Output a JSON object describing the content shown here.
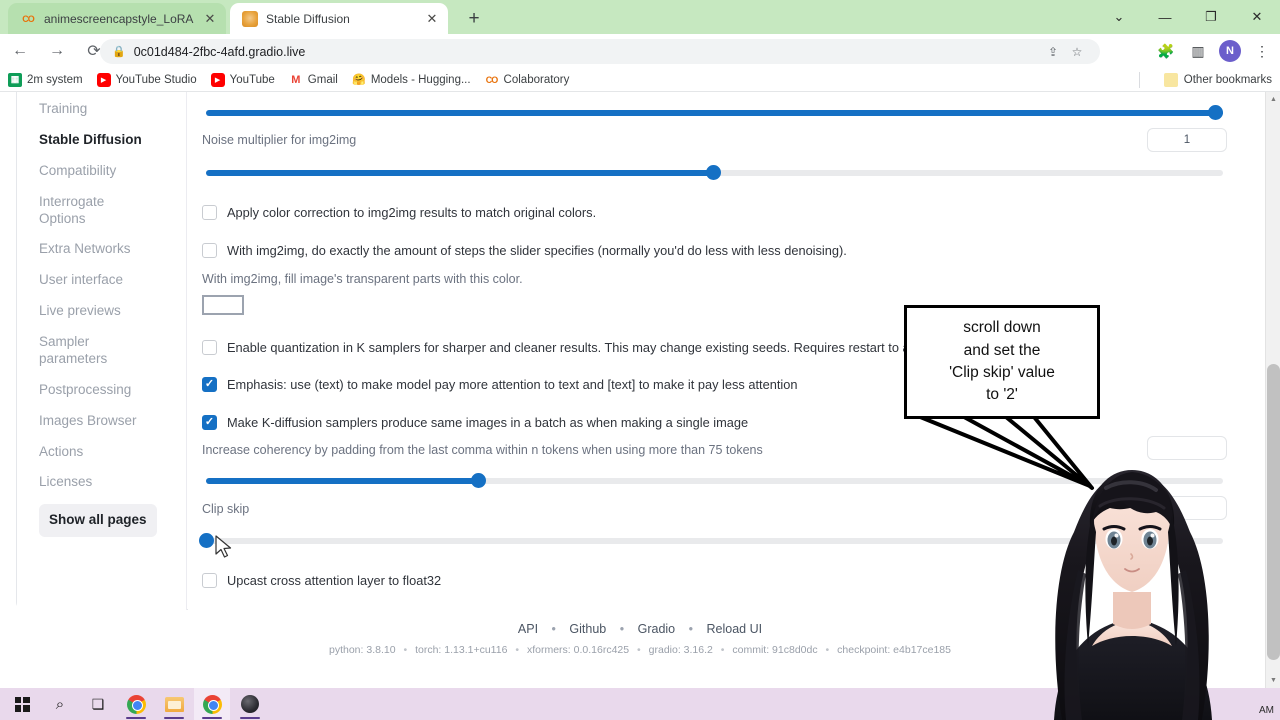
{
  "browser": {
    "tabs": [
      {
        "title": "animescreencapstyle_LoRA.ipynb",
        "favicon": "colab-icon",
        "active": false
      },
      {
        "title": "Stable Diffusion",
        "favicon": "stable-diffusion-icon",
        "active": true
      }
    ],
    "new_tab_label": "+",
    "window_controls": {
      "expand": "⌄",
      "minimize": "—",
      "maximize": "❐",
      "close": "✕"
    },
    "nav": {
      "back": "←",
      "forward": "→",
      "reload": "⟳"
    },
    "omnibox": {
      "url": "0c01d484-2fbc-4afd.gradio.live",
      "lock": "🔒",
      "share": "⇧",
      "star": "☆"
    },
    "toolbar_icons": {
      "extensions": "🧩",
      "sidepanel": "▢",
      "profile": "N",
      "menu": "⋮"
    },
    "bookmarks": [
      {
        "label": "2m system",
        "icon": "sheets-icon"
      },
      {
        "label": "YouTube Studio",
        "icon": "youtube-icon"
      },
      {
        "label": "YouTube",
        "icon": "youtube-icon"
      },
      {
        "label": "Gmail",
        "icon": "gmail-icon"
      },
      {
        "label": "Models - Hugging...",
        "icon": "huggingface-icon"
      },
      {
        "label": "Colaboratory",
        "icon": "colab-icon"
      }
    ],
    "other_bookmarks": "Other bookmarks"
  },
  "sidebar": {
    "items": [
      {
        "label": "Training",
        "active": false
      },
      {
        "label": "Stable Diffusion",
        "active": true
      },
      {
        "label": "Compatibility",
        "active": false
      },
      {
        "label": "Interrogate Options",
        "active": false
      },
      {
        "label": "Extra Networks",
        "active": false
      },
      {
        "label": "User interface",
        "active": false
      },
      {
        "label": "Live previews",
        "active": false
      },
      {
        "label": "Sampler parameters",
        "active": false
      },
      {
        "label": "Postprocessing",
        "active": false
      },
      {
        "label": "Images Browser",
        "active": false
      },
      {
        "label": "Actions",
        "active": false
      },
      {
        "label": "Licenses",
        "active": false
      }
    ],
    "show_all_pages": "Show all pages"
  },
  "settings": {
    "slider_top": {
      "value_pct": 100
    },
    "noise_multiplier": {
      "label": "Noise multiplier for img2img",
      "value": "1",
      "value_pct": 50
    },
    "checkbox_color_correction": {
      "label": "Apply color correction to img2img results to match original colors.",
      "checked": false
    },
    "checkbox_exact_steps": {
      "label": "With img2img, do exactly the amount of steps the slider specifies (normally you'd do less with less denoising).",
      "checked": false
    },
    "fill_color_label": "With img2img, fill image's transparent parts with this color.",
    "fill_color_value": "#ffffff",
    "checkbox_quantization": {
      "label": "Enable quantization in K samplers for sharper and cleaner results. This may change existing seeds. Requires restart to apply.",
      "checked": false
    },
    "checkbox_emphasis": {
      "label": "Emphasis: use (text) to make model pay more attention to text and [text] to make it pay less attention",
      "checked": true
    },
    "checkbox_kdiffusion_batch": {
      "label": "Make K-diffusion samplers produce same images in a batch as when making a single image",
      "checked": true
    },
    "padding_label": "Increase coherency by padding from the last comma within n tokens when using more than 75 tokens",
    "padding_slider": {
      "value_pct": 27
    },
    "clip_skip": {
      "label": "Clip skip",
      "value_pct": 0
    },
    "checkbox_upcast": {
      "label": "Upcast cross attention layer to float32",
      "checked": false
    }
  },
  "footer": {
    "links": [
      "API",
      "Github",
      "Gradio",
      "Reload UI"
    ],
    "separator": "•",
    "versions": [
      "python: 3.8.10",
      "torch: 1.13.1+cu116",
      "xformers: 0.0.16rc425",
      "gradio: 3.16.2",
      "commit: 91c8d0dc",
      "checkpoint: e4b17ce185"
    ]
  },
  "callout": {
    "line1": "scroll down",
    "line2": "and set the",
    "line3": "'Clip skip' value",
    "line4": "to '2'"
  },
  "taskbar": {
    "items": [
      {
        "name": "start-button",
        "icon": "windows-logo-icon"
      },
      {
        "name": "search-button",
        "icon": "search-icon"
      },
      {
        "name": "task-view-button",
        "icon": "task-view-icon"
      },
      {
        "name": "chrome-taskbar-1",
        "icon": "chrome-icon"
      },
      {
        "name": "file-explorer",
        "icon": "explorer-icon"
      },
      {
        "name": "chrome-taskbar-2",
        "icon": "chrome-icon"
      },
      {
        "name": "browser-dark",
        "icon": "dark-browser-icon"
      }
    ],
    "clock": "AM"
  },
  "colors": {
    "tabstrip": "#c6e8c0",
    "accent_blue": "#1570c4",
    "taskbar": "#e9d9ec"
  }
}
